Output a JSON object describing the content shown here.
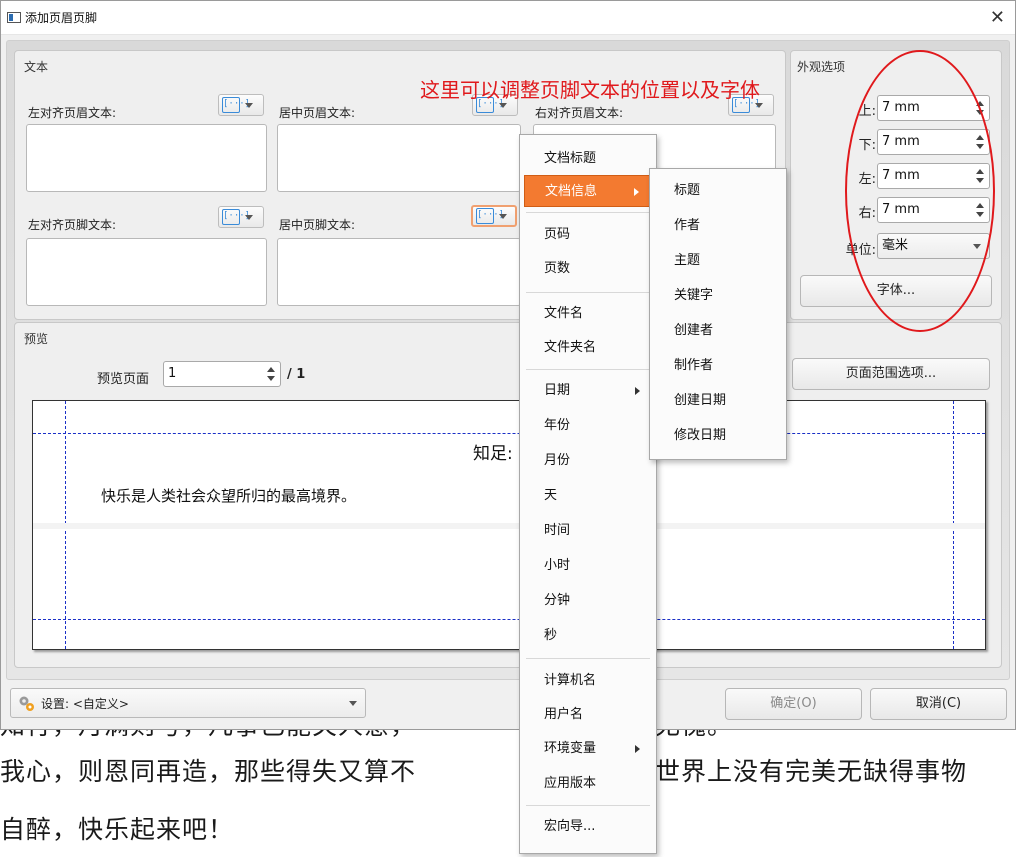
{
  "dialog": {
    "title": "添加页眉页脚",
    "close_glyph": "✕"
  },
  "text_group": {
    "title": "文本",
    "left_header_label": "左对齐页眉文本:",
    "center_header_label": "居中页眉文本:",
    "right_header_label": "右对齐页眉文本:",
    "left_footer_label": "左对齐页脚文本:",
    "center_footer_label": "居中页脚文本:",
    "var_icon_glyph": "[···]"
  },
  "appearance": {
    "title": "外观选项",
    "top_label": "上:",
    "top_value": "7 mm",
    "bottom_label": "下:",
    "bottom_value": "7 mm",
    "left_label": "左:",
    "left_value": "7 mm",
    "right_label": "右:",
    "right_value": "7 mm",
    "unit_label": "单位:",
    "unit_value": "毫米",
    "font_button": "字体..."
  },
  "preview": {
    "title": "预览",
    "page_label": "预览页面",
    "page_value": "1",
    "page_total": "/ 1",
    "range_button": "页面范围选项...",
    "doc_title": "知足:",
    "doc_line1": "快乐是人类社会众望所归的最高境界。"
  },
  "bottom_bar": {
    "settings_value": "设置: <自定义>",
    "ok_button": "确定(O)",
    "cancel_button": "取消(C)"
  },
  "annotation": {
    "text": "这里可以调整页脚文本的位置以及字体",
    "color": "#e0191c"
  },
  "context_menu": {
    "items": [
      {
        "label": "文档标题"
      },
      {
        "label": "文档信息"
      },
      {
        "label": "页码"
      },
      {
        "label": "页数"
      },
      {
        "label": "文件名"
      },
      {
        "label": "文件夹名"
      },
      {
        "label": "日期"
      },
      {
        "label": "年份"
      },
      {
        "label": "月份"
      },
      {
        "label": "天"
      },
      {
        "label": "时间"
      },
      {
        "label": "小时"
      },
      {
        "label": "分钟"
      },
      {
        "label": "秒"
      },
      {
        "label": "计算机名"
      },
      {
        "label": "用户名"
      },
      {
        "label": "环境变量"
      },
      {
        "label": "应用版本"
      },
      {
        "label": "宏向导..."
      }
    ],
    "highlight_color": "#f37a30"
  },
  "submenu": {
    "items": [
      {
        "label": "标题"
      },
      {
        "label": "作者"
      },
      {
        "label": "主题"
      },
      {
        "label": "关键字"
      },
      {
        "label": "创建者"
      },
      {
        "label": "制作者"
      },
      {
        "label": "创建日期"
      },
      {
        "label": "修改日期"
      }
    ]
  },
  "background_document": {
    "line1": "知行，月满则亏，凡事已能关人意，",
    "line1_tail": "无愧。",
    "line2": "我心，则恩同再造，那些得失又算不",
    "line2_tail": "世界上没有完美无缺得事物",
    "line3": "自醉，快乐起来吧！"
  }
}
